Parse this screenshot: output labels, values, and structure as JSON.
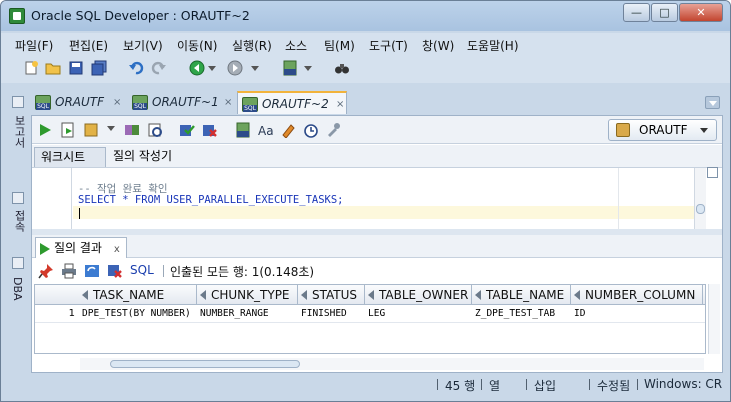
{
  "window": {
    "title": "Oracle SQL Developer : ORAUTF~2",
    "min_label": "—",
    "max_label": "□",
    "close_label": "✕"
  },
  "menu": [
    "파일(F)",
    "편집(E)",
    "보기(V)",
    "이동(N)",
    "실행(R)",
    "소스",
    "팀(M)",
    "도구(T)",
    "창(W)",
    "도움말(H)"
  ],
  "side_labels": {
    "reports": "보고서",
    "connections": "접속",
    "dba": "DBA"
  },
  "tabs": [
    {
      "label": "ORAUTF",
      "close": "×"
    },
    {
      "label": "ORAUTF~1",
      "close": "×"
    },
    {
      "label": "ORAUTF~2",
      "close": "×"
    }
  ],
  "connection": {
    "selected": "ORAUTF"
  },
  "subtabs": {
    "worksheet": "워크시트",
    "query_builder": "질의 작성기"
  },
  "editor": {
    "comment": "-- 작업 완료 확인",
    "statement": "SELECT * FROM USER_PARALLEL_EXECUTE_TASKS;"
  },
  "results": {
    "tab_label": "질의 결과",
    "tab_close": "x",
    "sql_label": "SQL",
    "fetch_text": "인출된 모든 행: 1(0.148초)",
    "columns": [
      "TASK_NAME",
      "CHUNK_TYPE",
      "STATUS",
      "TABLE_OWNER",
      "TABLE_NAME",
      "NUMBER_COLUMN"
    ],
    "rows": [
      {
        "num": "1",
        "cells": [
          "DPE_TEST(BY NUMBER)",
          "NUMBER_RANGE",
          "FINISHED",
          "LEG",
          "Z_DPE_TEST_TAB",
          "ID"
        ]
      }
    ]
  },
  "status": {
    "position": "45 행",
    "column": "열",
    "insert_mode": "삽입",
    "modified": "수정됨",
    "line_ending": "Windows: CR"
  },
  "colors": {
    "accent_tab": "#f2b33b",
    "keyword_blue": "#1a36b8",
    "run_green": "#2e9a2e"
  }
}
